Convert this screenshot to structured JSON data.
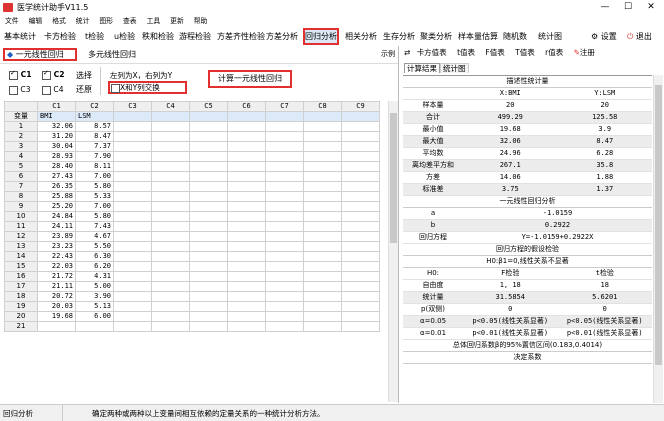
{
  "app": {
    "title": "医学统计助手V11.5",
    "close_glyph": "✕",
    "minimize_glyph": "—",
    "maximize_glyph": "☐"
  },
  "menu": [
    "文件",
    "编辑",
    "格式",
    "统计",
    "图形",
    "查表",
    "工具",
    "更新",
    "帮助"
  ],
  "toolbar": {
    "items": [
      "基本统计",
      "卡方检验",
      "t检验",
      "u检验",
      "秩和检验",
      "游程检验",
      "方差齐性检验",
      "方差分析",
      "回归分析",
      "相关分析",
      "生存分析",
      "聚类分析",
      "样本量估算",
      "随机数",
      "统计图"
    ],
    "active": "回归分析",
    "settings_label": "设置",
    "exit_label": "退出"
  },
  "regression_types": {
    "simple": "一元线性回归",
    "multiple": "多元线性回归",
    "example": "示例"
  },
  "controls": {
    "c1": "C1",
    "c2": "C2",
    "c3": "C3",
    "c4": "C4",
    "select": "选择",
    "restore": "还原",
    "hint": "左列为X，右列为Y",
    "swap": "X和Y列交换",
    "compute": "计算一元线性回归"
  },
  "grid": {
    "corner": "",
    "columns": [
      "C1",
      "C2",
      "C3",
      "C4",
      "C5",
      "C6",
      "C7",
      "C8",
      "C9"
    ],
    "var_label": "变量",
    "var_names": [
      "BMI",
      "LSM"
    ],
    "rows": [
      [
        "32.06",
        "8.57"
      ],
      [
        "31.20",
        "8.47"
      ],
      [
        "30.04",
        "7.37"
      ],
      [
        "28.93",
        "7.90"
      ],
      [
        "28.40",
        "8.11"
      ],
      [
        "27.43",
        "7.00"
      ],
      [
        "26.35",
        "5.80"
      ],
      [
        "25.88",
        "5.33"
      ],
      [
        "25.20",
        "7.00"
      ],
      [
        "24.84",
        "5.80"
      ],
      [
        "24.11",
        "7.43"
      ],
      [
        "23.89",
        "4.67"
      ],
      [
        "23.23",
        "5.50"
      ],
      [
        "22.43",
        "6.30"
      ],
      [
        "22.03",
        "6.20"
      ],
      [
        "21.72",
        "4.31"
      ],
      [
        "21.11",
        "5.00"
      ],
      [
        "20.72",
        "3.90"
      ],
      [
        "20.03",
        "5.13"
      ],
      [
        "19.68",
        "6.00"
      ],
      [
        "",
        ""
      ]
    ]
  },
  "right_tabs": [
    "卡方值表",
    "t值表",
    "F值表",
    "T值表",
    "r值表",
    "注册"
  ],
  "result_tabs": [
    "计算结果",
    "统计图"
  ],
  "stats": {
    "desc_title": "描述性统计量",
    "col_x": "X:BMI",
    "col_y": "Y:LSM",
    "desc": [
      [
        "样本量",
        "20",
        "20"
      ],
      [
        "合计",
        "499.29",
        "125.58"
      ],
      [
        "最小值",
        "19.68",
        "3.9"
      ],
      [
        "最大值",
        "32.06",
        "8.47"
      ],
      [
        "平均数",
        "24.96",
        "6.28"
      ],
      [
        "离均差平方和",
        "267.1",
        "35.8"
      ],
      [
        "方差",
        "14.06",
        "1.88"
      ],
      [
        "标准差",
        "3.75",
        "1.37"
      ]
    ],
    "reg_title": "一元线性回归分析",
    "reg": [
      [
        "a",
        "-1.0159"
      ],
      [
        "b",
        "0.2922"
      ],
      [
        "回归方程",
        "Y=-1.0159+0.2922X"
      ]
    ],
    "test_title": "回归方程的假设检验",
    "h0": "H0:β1=0,线性关系不显著",
    "test_head": [
      "H0:",
      "F检验",
      "t检验"
    ],
    "test": [
      [
        "自由度",
        "1, 18",
        "18"
      ],
      [
        "统计量",
        "31.5854",
        "5.6201"
      ],
      [
        "p(双侧)",
        "0",
        "0"
      ],
      [
        "α=0.05",
        "p<0.05(线性关系显著)",
        "p<0.05(线性关系显著)"
      ],
      [
        "α=0.01",
        "p<0.01(线性关系显著)",
        "p<0.01(线性关系显著)"
      ]
    ],
    "ci": "总体回归系数β的95%置信区间(0.183,0.4014)",
    "coef_title": "决定系数"
  },
  "status": {
    "left": "回归分析",
    "desc": "确定两种或两种以上变量间相互依赖的定量关系的一种统计分析方法。"
  }
}
